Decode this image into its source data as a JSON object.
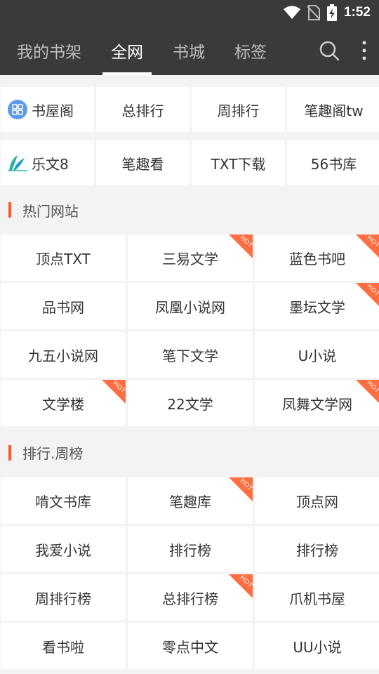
{
  "status": {
    "time": "1:52"
  },
  "tabs": [
    {
      "label": "我的书架",
      "active": false
    },
    {
      "label": "全网",
      "active": true
    },
    {
      "label": "书城",
      "active": false
    },
    {
      "label": "标签",
      "active": false
    }
  ],
  "quick_links": [
    {
      "label": "书屋阁",
      "icon": "grid-app-icon"
    },
    {
      "label": "总排行"
    },
    {
      "label": "周排行"
    },
    {
      "label": "笔趣阁tw"
    },
    {
      "label": "乐文8",
      "icon": "leaf-logo-icon"
    },
    {
      "label": "笔趣看"
    },
    {
      "label": "TXT下载"
    },
    {
      "label": "56书库"
    }
  ],
  "hot_sites": {
    "title": "热门网站",
    "items": [
      {
        "label": "顶点TXT",
        "hot": false
      },
      {
        "label": "三易文学",
        "hot": true
      },
      {
        "label": "蓝色书吧",
        "hot": true
      },
      {
        "label": "品书网",
        "hot": false
      },
      {
        "label": "凤凰小说网",
        "hot": false
      },
      {
        "label": "墨坛文学",
        "hot": true
      },
      {
        "label": "九五小说网",
        "hot": false
      },
      {
        "label": "笔下文学",
        "hot": false
      },
      {
        "label": "U小说",
        "hot": false
      },
      {
        "label": "文学楼",
        "hot": true
      },
      {
        "label": "22文学",
        "hot": false
      },
      {
        "label": "凤舞文学网",
        "hot": true
      }
    ]
  },
  "rankings": {
    "title": "排行.周榜",
    "items": [
      {
        "label": "啃文书库",
        "hot": false
      },
      {
        "label": "笔趣库",
        "hot": true
      },
      {
        "label": "顶点网",
        "hot": false
      },
      {
        "label": "我爱小说",
        "hot": false
      },
      {
        "label": "排行榜",
        "hot": false
      },
      {
        "label": "排行榜",
        "hot": false
      },
      {
        "label": "周排行榜",
        "hot": false
      },
      {
        "label": "总排行榜",
        "hot": true
      },
      {
        "label": "爪机书屋",
        "hot": false
      },
      {
        "label": "看书啦",
        "hot": false
      },
      {
        "label": "零点中文",
        "hot": false
      },
      {
        "label": "UU小说",
        "hot": false
      }
    ]
  },
  "hot_badge": "HOT",
  "colors": {
    "topbar": "#3a3a3a",
    "accent": "#ff5a2b",
    "hot_badge": "#ff6e40"
  }
}
